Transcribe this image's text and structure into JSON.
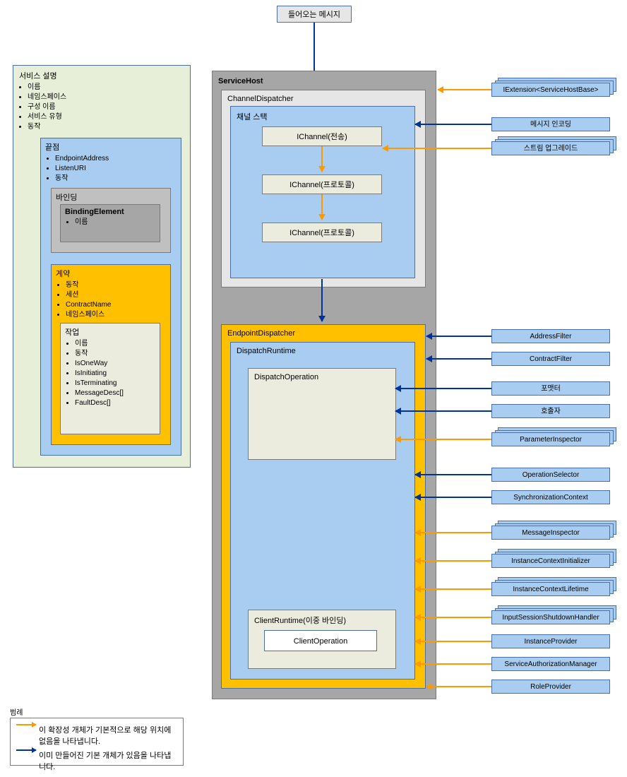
{
  "incoming_message": "들어오는 메시지",
  "service_description": {
    "title": "서비스 설명",
    "items": [
      "이름",
      "네임스페이스",
      "구성 이름",
      "서비스 유형",
      "동작"
    ],
    "endpoint": {
      "title": "끝점",
      "items": [
        "EndpointAddress",
        "ListenURI",
        "동작"
      ],
      "binding": {
        "title": "바인딩",
        "element_title": "BindingElement",
        "element_items": [
          "이름"
        ]
      },
      "contract": {
        "title": "계약",
        "items": [
          "동작",
          "세션",
          "ContractName",
          "네임스페이스"
        ],
        "operation": {
          "title": "작업",
          "items": [
            "이름",
            "동작",
            "IsOneWay",
            "IsInitiating",
            "IsTerminating",
            "MessageDesc[]",
            "FaultDesc[]"
          ]
        }
      }
    }
  },
  "servicehost": {
    "title": "ServiceHost",
    "channel_dispatcher": {
      "title": "ChannelDispatcher",
      "channel_stack": {
        "title": "채널 스택",
        "items": [
          "IChannel(전송)",
          "IChannel(프로토콜)",
          "IChannel(프로토콜)"
        ]
      }
    },
    "endpoint_dispatcher": {
      "title": "EndpointDispatcher",
      "dispatch_runtime": {
        "title": "DispatchRuntime",
        "dispatch_operation": "DispatchOperation",
        "client_runtime": "ClientRuntime(이중 바인딩)",
        "client_operation": "ClientOperation"
      }
    }
  },
  "extensions": {
    "iextension": "IExtension<ServiceHostBase>",
    "msg_encoding": "메시지 인코딩",
    "stream_upgrade": "스트림 업그레이드",
    "address_filter": "AddressFilter",
    "contract_filter": "ContractFilter",
    "formatter": "포맷터",
    "invoker": "호출자",
    "param_inspector": "ParameterInspector",
    "op_selector": "OperationSelector",
    "sync_context": "SynchronizationContext",
    "msg_inspector": "MessageInspector",
    "ictx_initializer": "InstanceContextInitializer",
    "ictx_lifetime": "InstanceContextLifetime",
    "input_shutdown": "InputSessionShutdownHandler",
    "instance_provider": "InstanceProvider",
    "svc_authz": "ServiceAuthorizationManager",
    "role_provider": "RoleProvider"
  },
  "legend": {
    "title": "범례",
    "orange": "이 확장성 개체가 기본적으로 해당 위치에 없음을 나타냅니다.",
    "blue": "이미 만들어진 기본 개체가 있음을 나타냅니다."
  }
}
